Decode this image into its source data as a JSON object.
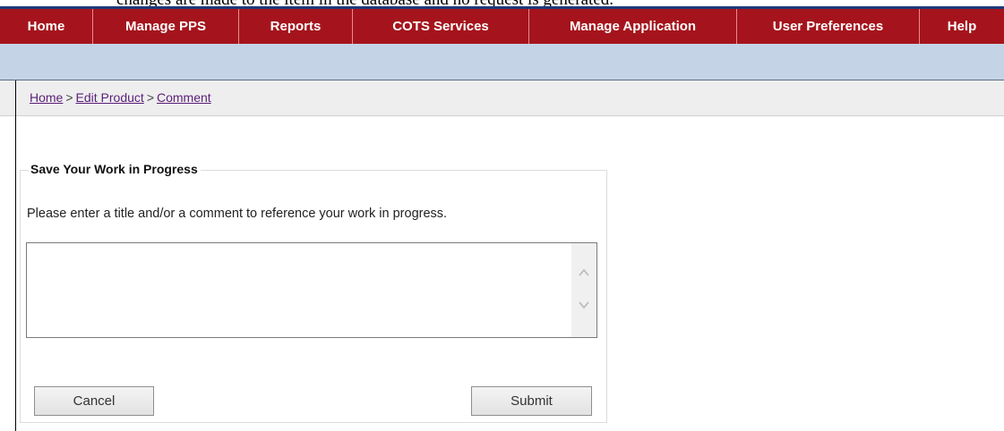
{
  "document_fragment": "changes are made to the item in the database and no request is generated.",
  "navbar": {
    "items": [
      {
        "label": "Home"
      },
      {
        "label": "Manage PPS"
      },
      {
        "label": "Reports"
      },
      {
        "label": "COTS Services"
      },
      {
        "label": "Manage Application"
      },
      {
        "label": "User Preferences"
      },
      {
        "label": "Help"
      }
    ]
  },
  "breadcrumb": {
    "home": "Home",
    "sep1": ">",
    "edit_product": "Edit Product",
    "sep2": ">",
    "comment": "Comment"
  },
  "form": {
    "legend": "Save Your Work in Progress",
    "instructions": "Please enter a title and/or a comment to reference your work in progress.",
    "comment_value": "",
    "cancel_label": "Cancel",
    "submit_label": "Submit"
  },
  "icons": {
    "scroll_up": "chevron-up-icon",
    "scroll_down": "chevron-down-icon"
  },
  "colors": {
    "nav_background": "#a5141c",
    "nav_text": "#ffffff",
    "sub_band": "#c5d3e6",
    "breadcrumb_link": "#5b1f7a"
  }
}
